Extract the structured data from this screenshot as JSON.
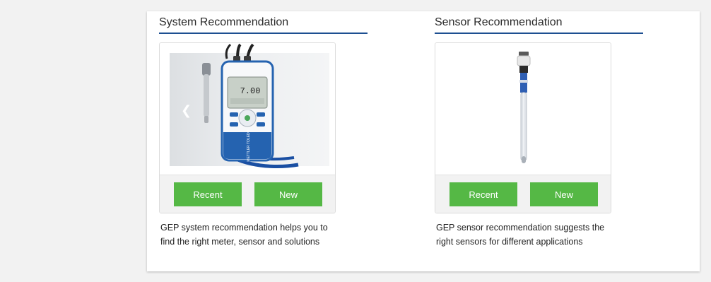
{
  "system": {
    "title": "System Recommendation",
    "recent_label": "Recent",
    "new_label": "New",
    "description_line1": "GEP system recommendation helps you to",
    "description_line2": "find the right meter, sensor and solutions",
    "meter_display": "7.00",
    "brand": "METTLER TOLEDO"
  },
  "sensor": {
    "title": "Sensor Recommendation",
    "recent_label": "Recent",
    "new_label": "New",
    "description_line1": "GEP sensor recommendation suggests the",
    "description_line2": "right sensors for different applications"
  },
  "colors": {
    "accent_green": "#55b845",
    "heading_rule": "#1d4f91",
    "meter_blue": "#2563b0",
    "lanyard_blue": "#1a4fa3"
  },
  "icons": {
    "carousel_prev": "chevron-left-icon"
  }
}
